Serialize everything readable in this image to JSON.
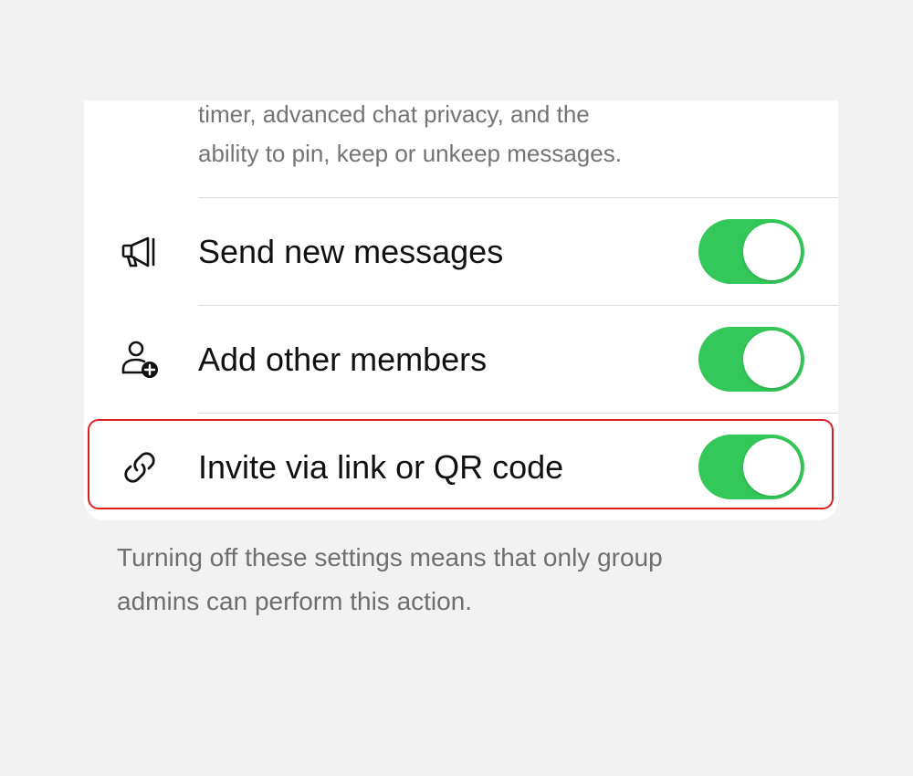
{
  "permissions": {
    "description_lines": [
      "timer, advanced chat privacy, and the",
      "ability to pin, keep or unkeep messages."
    ],
    "rows": [
      {
        "label": "Send new messages",
        "icon": "megaphone-icon",
        "enabled": true
      },
      {
        "label": "Add other members",
        "icon": "add-person-icon",
        "enabled": true
      },
      {
        "label": "Invite via link or QR code",
        "icon": "link-icon",
        "enabled": true
      }
    ],
    "footer_lines": [
      "Turning off these settings means that only group",
      "admins can perform this action."
    ]
  },
  "colors": {
    "toggle_on": "#34c759",
    "highlight": "#e02020",
    "background": "#f2f2f2"
  }
}
